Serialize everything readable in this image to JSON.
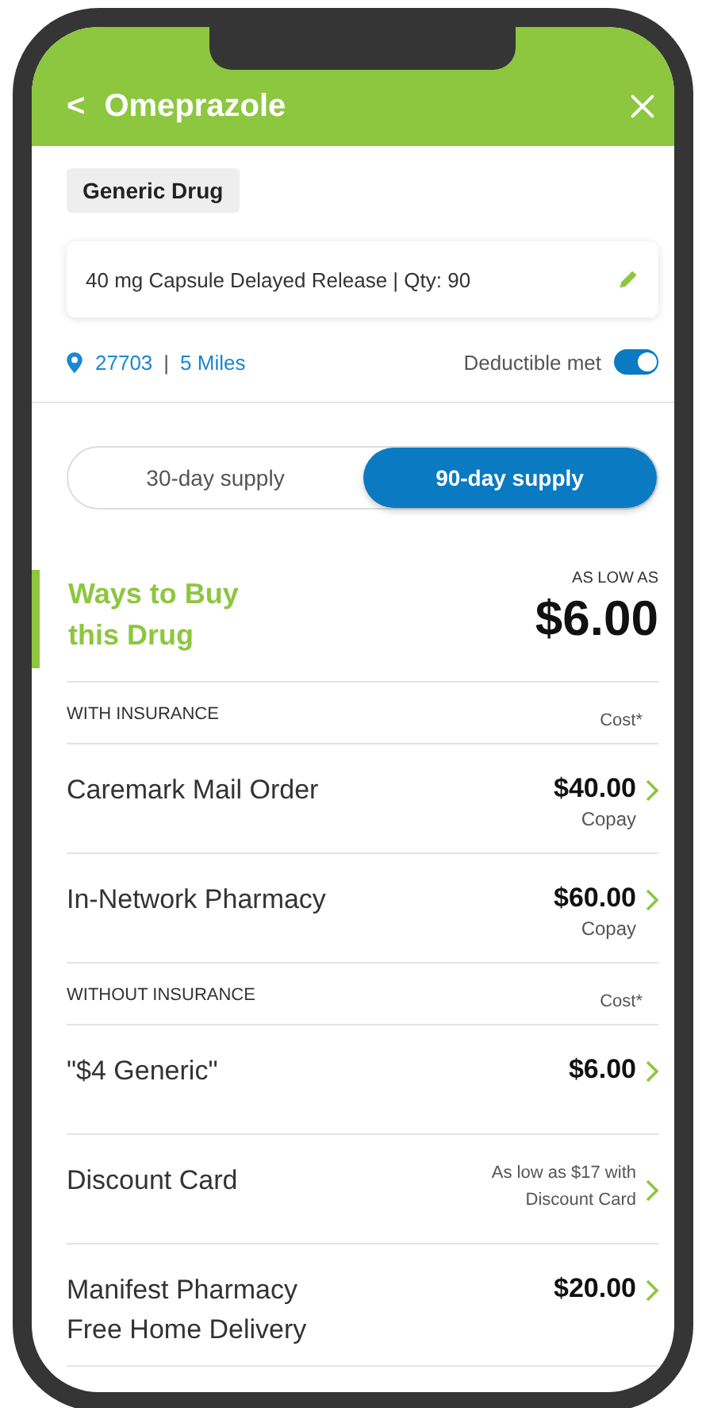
{
  "header": {
    "back": "<",
    "title": "Omeprazole"
  },
  "drug_type": "Generic Drug",
  "dosage": {
    "text": "40 mg Capsule Delayed Release | Qty: 90"
  },
  "location": {
    "zip": "27703",
    "separator": "|",
    "distance": "5 Miles"
  },
  "deductible": {
    "label": "Deductible met",
    "on": true
  },
  "tabs": [
    {
      "label": "30-day supply",
      "selected": false
    },
    {
      "label": "90-day supply",
      "selected": true
    }
  ],
  "ways": {
    "title": "Ways to Buy\nthis Drug",
    "low_label": "AS LOW AS",
    "low_price": "$6.00"
  },
  "sections": [
    {
      "title": "WITH INSURANCE",
      "cost_label": "Cost*",
      "rows": [
        {
          "kind": "price",
          "name": "Caremark Mail Order",
          "price": "$40.00",
          "sub": "Copay"
        },
        {
          "kind": "price",
          "name": "In-Network Pharmacy",
          "price": "$60.00",
          "sub": "Copay"
        }
      ]
    },
    {
      "title": "WITHOUT INSURANCE",
      "cost_label": "Cost*",
      "rows": [
        {
          "kind": "price",
          "name": "\"$4 Generic\"",
          "price": "$6.00"
        },
        {
          "kind": "note",
          "name": "Discount Card",
          "note": "As low as $17 with\nDiscount Card"
        },
        {
          "kind": "price",
          "name": "Manifest Pharmacy\nFree Home Delivery",
          "price": "$20.00"
        }
      ]
    }
  ]
}
